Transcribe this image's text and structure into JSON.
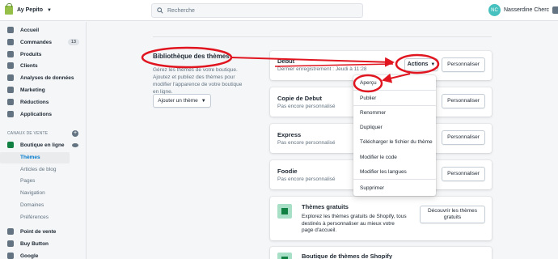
{
  "topbar": {
    "store_name": "Ay Pepito",
    "search_placeholder": "Recherche",
    "user_initials": "NC",
    "user_name": "Nasserdine Cherc"
  },
  "sidebar": {
    "items": [
      {
        "label": "Accueil"
      },
      {
        "label": "Commandes",
        "badge": "13"
      },
      {
        "label": "Produits"
      },
      {
        "label": "Clients"
      },
      {
        "label": "Analyses de données"
      },
      {
        "label": "Marketing"
      },
      {
        "label": "Réductions"
      },
      {
        "label": "Applications"
      }
    ],
    "sales_channels_title": "CANAUX DE VENTE",
    "online_store": "Boutique en ligne",
    "sub_items": [
      "Thèmes",
      "Articles de blog",
      "Pages",
      "Navigation",
      "Domaines",
      "Préférences"
    ],
    "bottom_items": [
      "Point de vente",
      "Buy Button",
      "Google"
    ]
  },
  "main": {
    "library_title": "Bibliothèque des thèmes",
    "library_desc": "Gérez les thèmes de votre boutique. Ajoutez et publiez des thèmes pour modifier l'apparence de votre boutique en ligne.",
    "add_theme_label": "Ajouter un thème",
    "themes": [
      {
        "name": "Debut",
        "sub": "Dernier enregistrement : Jeudi à 11:28",
        "customize": "Personnaliser"
      },
      {
        "name": "Copie de Debut",
        "sub": "Pas encore personnalisé",
        "customize": "Personnaliser"
      },
      {
        "name": "Express",
        "sub": "Pas encore personnalisé",
        "customize": "Personnaliser"
      },
      {
        "name": "Foodie",
        "sub": "Pas encore personnalisé",
        "customize": "Personnaliser"
      }
    ],
    "actions_label": "Actions",
    "free_themes": {
      "title": "Thèmes gratuits",
      "desc": "Explorez les thèmes gratuits de Shopify, tous destinés à personnaliser au mieux votre page d'accueil.",
      "button": "Découvrir les thèmes gratuits"
    },
    "theme_store": {
      "title": "Boutique de thèmes de Shopify"
    }
  },
  "actions_menu": {
    "items": [
      "Aperçu",
      "Publier",
      "Renommer",
      "Dupliquer",
      "Télécharger le fichier du thème",
      "Modifier le code",
      "Modifier les langues",
      "Supprimer"
    ]
  },
  "colors": {
    "accent": "#108043",
    "annotation": "#e0151f",
    "link": "#007ace"
  }
}
